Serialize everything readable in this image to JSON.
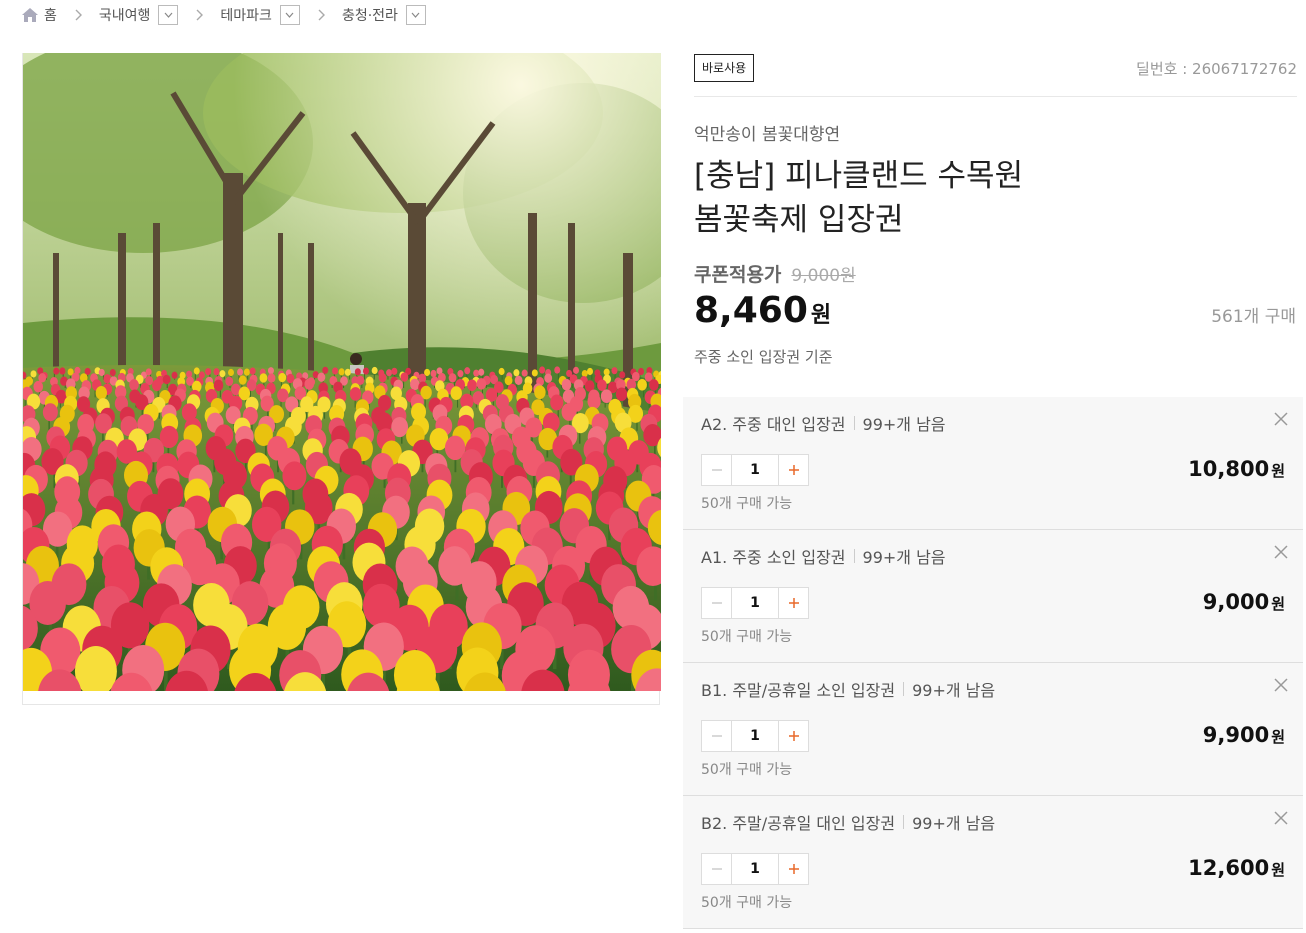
{
  "breadcrumb": {
    "home": "홈",
    "items": [
      {
        "label": "국내여행"
      },
      {
        "label": "테마파크"
      },
      {
        "label": "충청·전라"
      }
    ]
  },
  "product": {
    "badge": "바로사용",
    "deal_number": "딜번호 : 26067172762",
    "subtitle": "억만송이 봄꽃대향연",
    "title_line1": "[충남] 피나클랜드 수목원",
    "title_line2": "봄꽃축제 입장권",
    "coupon_label": "쿠폰적용가",
    "original_price": "9,000원",
    "price": "8,460",
    "price_unit": "원",
    "purchase_count": "561개 구매",
    "base_note": "주중 소인 입장권 기준"
  },
  "options": [
    {
      "name": "A2. 주중 대인 입장권",
      "stock": "99+개 남음",
      "quantity": "1",
      "limit": "50개 구매 가능",
      "price": "10,800",
      "unit": "원"
    },
    {
      "name": "A1. 주중 소인 입장권",
      "stock": "99+개 남음",
      "quantity": "1",
      "limit": "50개 구매 가능",
      "price": "9,000",
      "unit": "원"
    },
    {
      "name": "B1. 주말/공휴일 소인 입장권",
      "stock": "99+개 남음",
      "quantity": "1",
      "limit": "50개 구매 가능",
      "price": "9,900",
      "unit": "원"
    },
    {
      "name": "B2. 주말/공휴일 대인 입장권",
      "stock": "99+개 남음",
      "quantity": "1",
      "limit": "50개 구매 가능",
      "price": "12,600",
      "unit": "원"
    }
  ],
  "colors": {
    "accent_plus": "#e8692a",
    "text_main": "#222222",
    "muted": "#999999",
    "option_bg": "#f7f7f7"
  }
}
